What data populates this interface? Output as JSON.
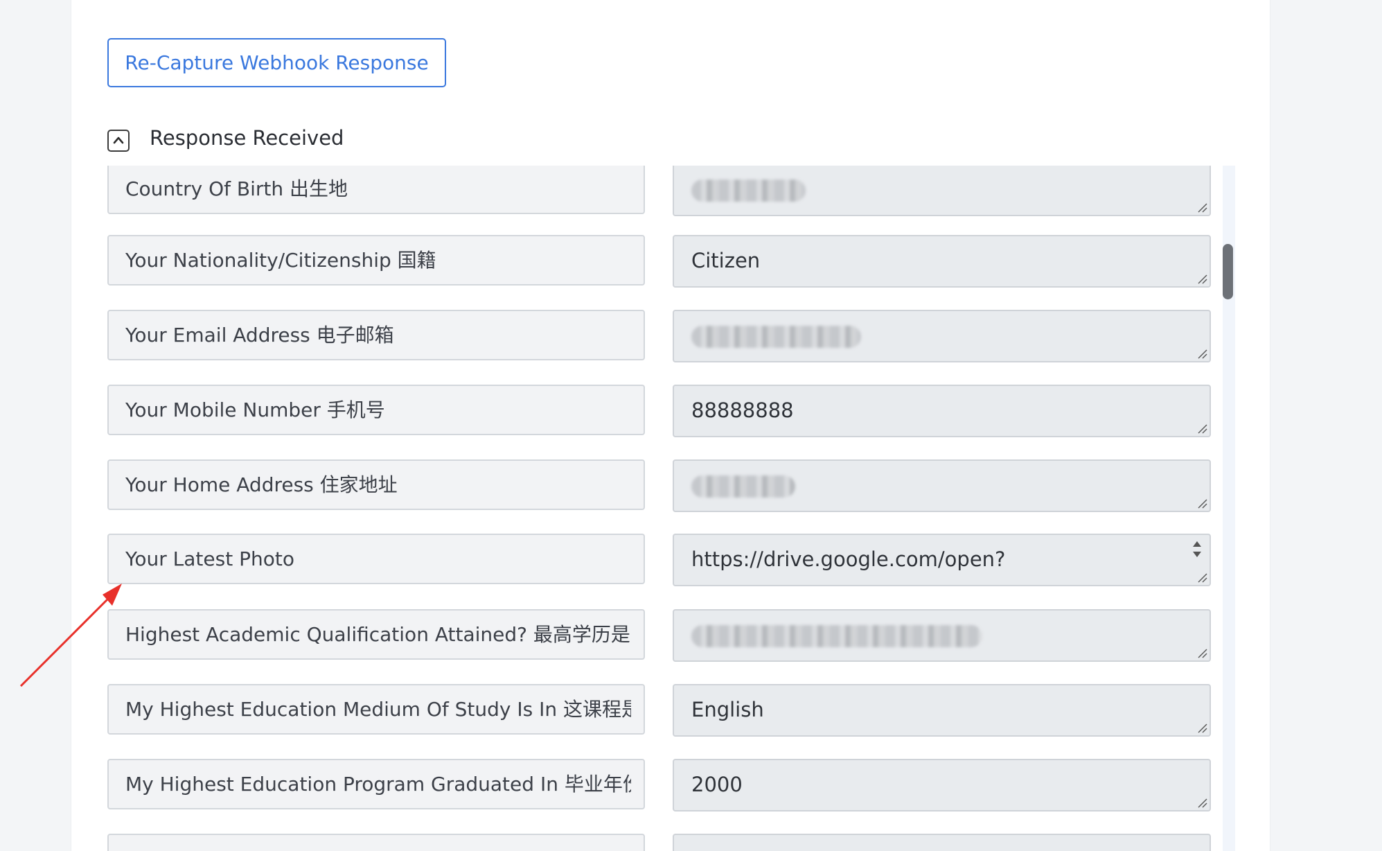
{
  "recapture_button": {
    "label": "Re-Capture Webhook Response"
  },
  "response_section": {
    "title": "Response Received",
    "toggle_icon": "chevron-up-icon",
    "rows": [
      {
        "key": "Country Of Birth 出生地",
        "value": "",
        "redacted": true
      },
      {
        "key": "Your Nationality/Citizenship 国籍",
        "value": "Citizen",
        "redacted": false
      },
      {
        "key": "Your Email Address 电子邮箱",
        "value": "",
        "redacted": true
      },
      {
        "key": "Your Mobile Number 手机号",
        "value": "88888888",
        "redacted": false
      },
      {
        "key": "Your Home Address 住家地址",
        "value": "",
        "redacted": true
      },
      {
        "key": "Your Latest Photo",
        "value": "https://drive.google.com/open?",
        "redacted": false
      },
      {
        "key": "Highest Academic Qualification Attained? 最高学历是",
        "value": "",
        "redacted": true
      },
      {
        "key": "My Highest Education Medium Of Study Is In 这课程是",
        "value": "English",
        "redacted": false
      },
      {
        "key": "My Highest Education Program Graduated In 毕业年份",
        "value": "2000",
        "redacted": false
      },
      {
        "key": "",
        "value": "",
        "redacted": false
      }
    ]
  },
  "colors": {
    "accent": "#3a78de",
    "annotation_arrow": "#e8302a"
  }
}
